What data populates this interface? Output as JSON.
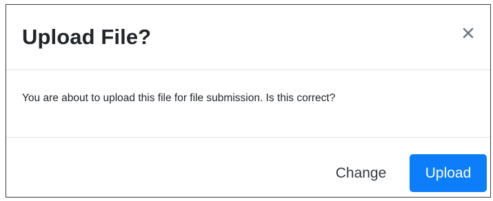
{
  "dialog": {
    "title": "Upload File?",
    "close_icon": "close-icon",
    "message": "You are about to upload this file for file submission. Is this correct?",
    "buttons": {
      "change_label": "Change",
      "upload_label": "Upload"
    }
  },
  "colors": {
    "primary": "#0d7ef9",
    "text": "#212529",
    "divider": "#dee2e6"
  }
}
